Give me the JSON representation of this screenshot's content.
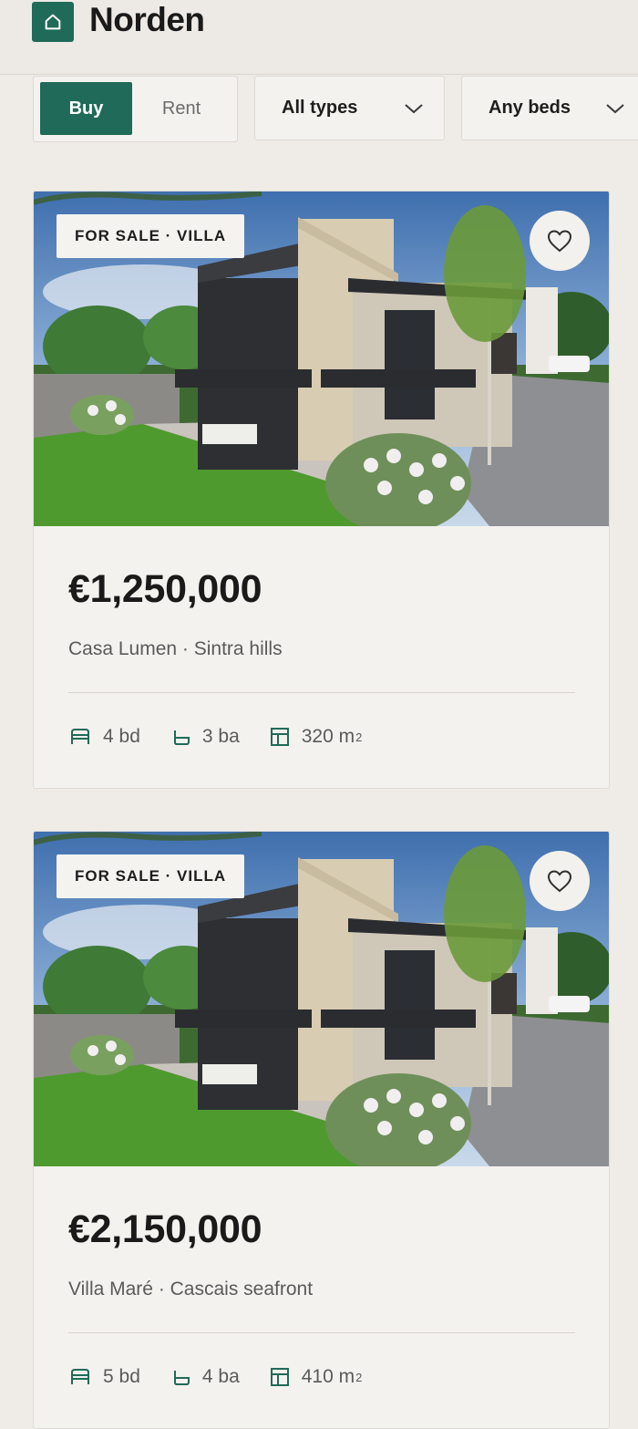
{
  "app": {
    "brand": "Norden",
    "accent_color": "#1f6a58",
    "logo_icon": "home-icon"
  },
  "filters": {
    "mode_options": [
      "Buy",
      "Rent"
    ],
    "mode_selected": "Buy",
    "type_select": "All types",
    "beds_select": "Any beds"
  },
  "listings": [
    {
      "tag": "FOR SALE · VILLA",
      "price": "€1,250,000",
      "address": "Casa Lumen · Sintra hills",
      "beds": "4 bd",
      "baths": "3 ba",
      "area": "320 m",
      "area_unit_sup": "2",
      "favorite_icon": "heart-outline-icon"
    },
    {
      "tag": "FOR SALE · VILLA",
      "price": "€2,150,000",
      "address": "Villa Maré · Cascais seafront",
      "beds": "5 bd",
      "baths": "4 ba",
      "area": "410 m",
      "area_unit_sup": "2",
      "favorite_icon": "heart-outline-icon"
    }
  ]
}
